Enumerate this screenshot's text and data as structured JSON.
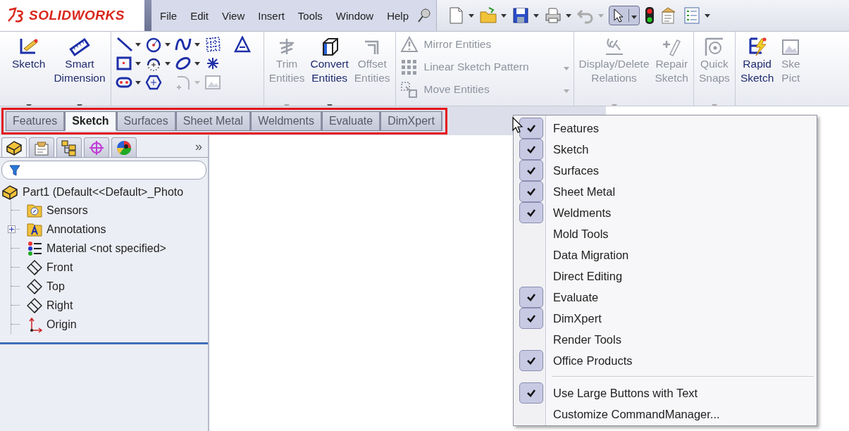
{
  "app": {
    "logo": "SOLIDWORKS"
  },
  "menu_bar": [
    "File",
    "Edit",
    "View",
    "Insert",
    "Tools",
    "Window",
    "Help"
  ],
  "ribbon": {
    "groups": [
      {
        "kind": "large",
        "buttons": [
          {
            "label": "Sketch",
            "disabled": false,
            "dropdown": true
          },
          {
            "label": "Smart\nDimension",
            "disabled": false,
            "dropdown": true
          }
        ]
      },
      {
        "kind": "icon_grid"
      },
      {
        "kind": "large",
        "buttons": [
          {
            "label": "Trim\nEntities",
            "disabled": true,
            "dropdown": true
          },
          {
            "label": "Convert\nEntities",
            "disabled": false,
            "dropdown": true
          },
          {
            "label": "Offset\nEntities",
            "disabled": true,
            "dropdown": false
          }
        ]
      },
      {
        "kind": "list",
        "buttons": [
          {
            "label": "Mirror Entities",
            "disabled": true,
            "dropdown": false
          },
          {
            "label": "Linear Sketch Pattern",
            "disabled": true,
            "dropdown": true
          },
          {
            "label": "Move Entities",
            "disabled": true,
            "dropdown": true
          }
        ]
      },
      {
        "kind": "large",
        "buttons": [
          {
            "label": "Display/Delete\nRelations",
            "disabled": true,
            "dropdown": true
          },
          {
            "label": "Repair\nSketch",
            "disabled": true,
            "dropdown": false
          }
        ]
      },
      {
        "kind": "large",
        "buttons": [
          {
            "label": "Quick\nSnaps",
            "disabled": true,
            "dropdown": true
          }
        ]
      },
      {
        "kind": "large",
        "buttons": [
          {
            "label": "Rapid\nSketch",
            "disabled": false,
            "dropdown": false
          },
          {
            "label": "Ske\nPict",
            "disabled": true,
            "dropdown": false
          }
        ]
      }
    ]
  },
  "command_tabs": [
    {
      "label": "Features",
      "selected": false
    },
    {
      "label": "Sketch",
      "selected": true
    },
    {
      "label": "Surfaces",
      "selected": false
    },
    {
      "label": "Sheet Metal",
      "selected": false
    },
    {
      "label": "Weldments",
      "selected": false
    },
    {
      "label": "Evaluate",
      "selected": false
    },
    {
      "label": "DimXpert",
      "selected": false
    }
  ],
  "feature_manager": {
    "panel_tabs": [
      {
        "selected": true
      },
      {
        "selected": false
      },
      {
        "selected": false
      },
      {
        "selected": false
      },
      {
        "selected": false
      }
    ],
    "more": "»",
    "tree": {
      "label": "Part1  (Default<<Default>_Photo",
      "children": [
        {
          "label": "Sensors",
          "expandable": false
        },
        {
          "label": "Annotations",
          "expandable": true,
          "expanded": false
        },
        {
          "label": "Material <not specified>",
          "expandable": false
        },
        {
          "label": "Front",
          "expandable": false
        },
        {
          "label": "Top",
          "expandable": false
        },
        {
          "label": "Right",
          "expandable": false
        },
        {
          "label": "Origin",
          "expandable": false
        }
      ]
    }
  },
  "context_menu": {
    "items": [
      {
        "kind": "check",
        "label": "Features",
        "checked": true
      },
      {
        "kind": "check",
        "label": "Sketch",
        "checked": true
      },
      {
        "kind": "check",
        "label": "Surfaces",
        "checked": true
      },
      {
        "kind": "check",
        "label": "Sheet Metal",
        "checked": true
      },
      {
        "kind": "check",
        "label": "Weldments",
        "checked": true
      },
      {
        "kind": "check",
        "label": "Mold Tools",
        "checked": false
      },
      {
        "kind": "check",
        "label": "Data Migration",
        "checked": false
      },
      {
        "kind": "check",
        "label": "Direct Editing",
        "checked": false
      },
      {
        "kind": "check",
        "label": "Evaluate",
        "checked": true
      },
      {
        "kind": "check",
        "label": "DimXpert",
        "checked": true
      },
      {
        "kind": "check",
        "label": "Render Tools",
        "checked": false
      },
      {
        "kind": "check",
        "label": "Office Products",
        "checked": true
      },
      {
        "kind": "separator"
      },
      {
        "kind": "check",
        "label": "Use Large Buttons with Text",
        "checked": true
      },
      {
        "kind": "check",
        "label": "Customize CommandManager...",
        "checked": false
      }
    ]
  }
}
